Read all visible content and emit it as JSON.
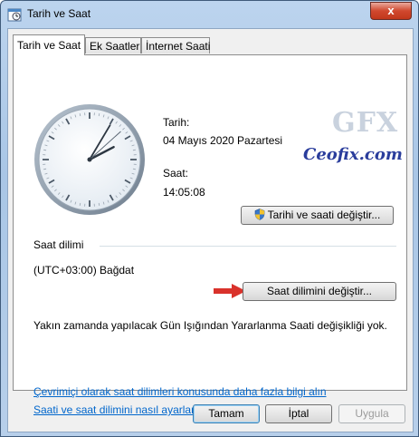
{
  "window": {
    "title": "Tarih ve Saat",
    "close_label": "x"
  },
  "tabs": [
    {
      "label": "Tarih ve Saat",
      "active": true
    },
    {
      "label": "Ek Saatler",
      "active": false
    },
    {
      "label": "İnternet Saati",
      "active": false
    }
  ],
  "date_section": {
    "date_label": "Tarih:",
    "date_value": "04 Mayıs 2020 Pazartesi",
    "time_label": "Saat:",
    "time_value": "14:05:08",
    "change_button": "Tarihi ve saati değiştir..."
  },
  "clock": {
    "hour": 14,
    "minute": 5,
    "second": 8
  },
  "watermark": {
    "line1": "GFX",
    "line2": "Ceofix.com"
  },
  "timezone": {
    "heading": "Saat dilimi",
    "value": "(UTC+03:00) Bağdat",
    "change_button": "Saat dilimini değiştir..."
  },
  "dst_message": "Yakın zamanda yapılacak Gün Işığından Yararlanma Saati değişikliği yok.",
  "links": {
    "online_info": "Çevrimiçi olarak saat dilimleri konusunda daha fazla bilgi alın",
    "how_to": "Saati ve saat dilimini nasıl ayarlarım?"
  },
  "footer": {
    "ok": "Tamam",
    "cancel": "İptal",
    "apply": "Uygula"
  },
  "colors": {
    "link": "#0066cc",
    "arrow": "#d9322b",
    "accent": "#3c7fb1"
  }
}
